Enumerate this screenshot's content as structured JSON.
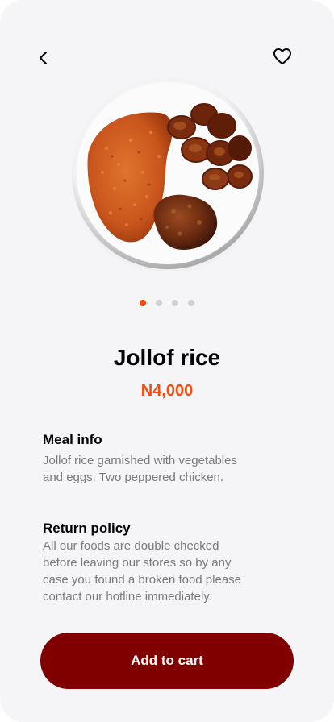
{
  "header": {
    "back_icon": "chevron-left-icon",
    "favorite_icon": "heart-outline-icon"
  },
  "carousel": {
    "image": "jollof-rice-plate-image",
    "total_slides": 4,
    "active_slide": 1
  },
  "product": {
    "name": "Jollof rice",
    "price": "N4,000"
  },
  "meal_info": {
    "heading": "Meal info",
    "lines": [
      "Jollof rice garnished with vegetables",
      "and eggs. Two peppered chicken."
    ]
  },
  "return_policy": {
    "heading": "Return policy",
    "lines": [
      "All our foods are double checked",
      "before leaving our stores so by any",
      "case you found a broken food please",
      "contact our hotline immediately."
    ]
  },
  "cta": {
    "label": "Add to cart"
  },
  "colors": {
    "background": "#f5f5f7",
    "accent": "#fa4a0c",
    "button": "#800000",
    "body_text": "#7a7a7a"
  }
}
